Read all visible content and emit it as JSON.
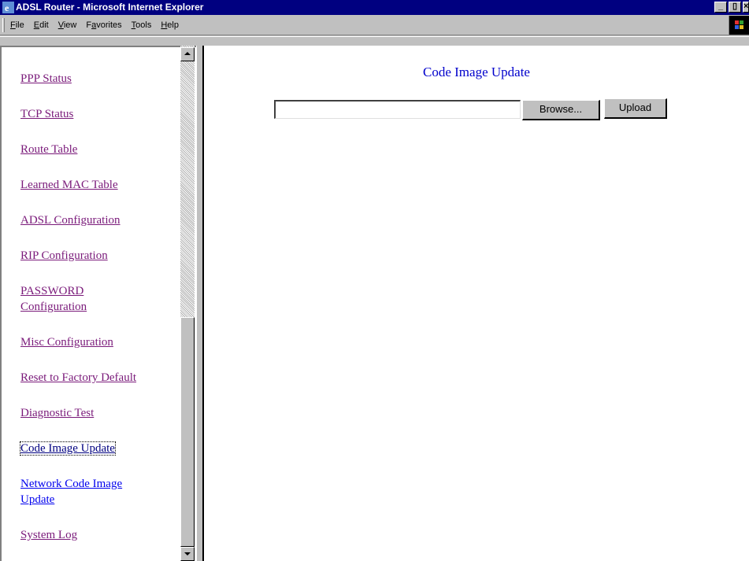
{
  "window": {
    "title": "ADSL Router - Microsoft Internet Explorer",
    "controls": [
      "_",
      "▯",
      "×"
    ]
  },
  "menu": {
    "items": [
      {
        "text": "File",
        "key": "F"
      },
      {
        "text": "Edit",
        "key": "E"
      },
      {
        "text": "View",
        "key": "V"
      },
      {
        "text": "Favorites",
        "key": "a"
      },
      {
        "text": "Tools",
        "key": "T"
      },
      {
        "text": "Help",
        "key": "H"
      }
    ]
  },
  "nav": {
    "links": [
      {
        "line1": "PPP Status",
        "line2": ""
      },
      {
        "line1": "TCP Status",
        "line2": ""
      },
      {
        "line1": "Route Table",
        "line2": ""
      },
      {
        "line1": "Learned MAC Table",
        "line2": ""
      },
      {
        "line1": "ADSL Configuration",
        "line2": ""
      },
      {
        "line1": "RIP Configuration",
        "line2": ""
      },
      {
        "line1": "PASSWORD",
        "line2": "Configuration"
      },
      {
        "line1": "Misc Configuration",
        "line2": ""
      },
      {
        "line1": "Reset to Factory Default",
        "line2": ""
      },
      {
        "line1": "Diagnostic Test",
        "line2": ""
      },
      {
        "line1": "Code Image Update",
        "line2": ""
      },
      {
        "line1": "Network Code Image",
        "line2": "Update"
      },
      {
        "line1": "System Log",
        "line2": ""
      }
    ],
    "current_index": 10
  },
  "content": {
    "title": "Code Image Update",
    "file_value": "",
    "browse_label": "Browse...",
    "upload_label": "Upload"
  },
  "colors": {
    "titlebar": "#000080",
    "visited_link": "#7a1a7a",
    "link": "#0000ee",
    "heading": "#0000cc"
  }
}
